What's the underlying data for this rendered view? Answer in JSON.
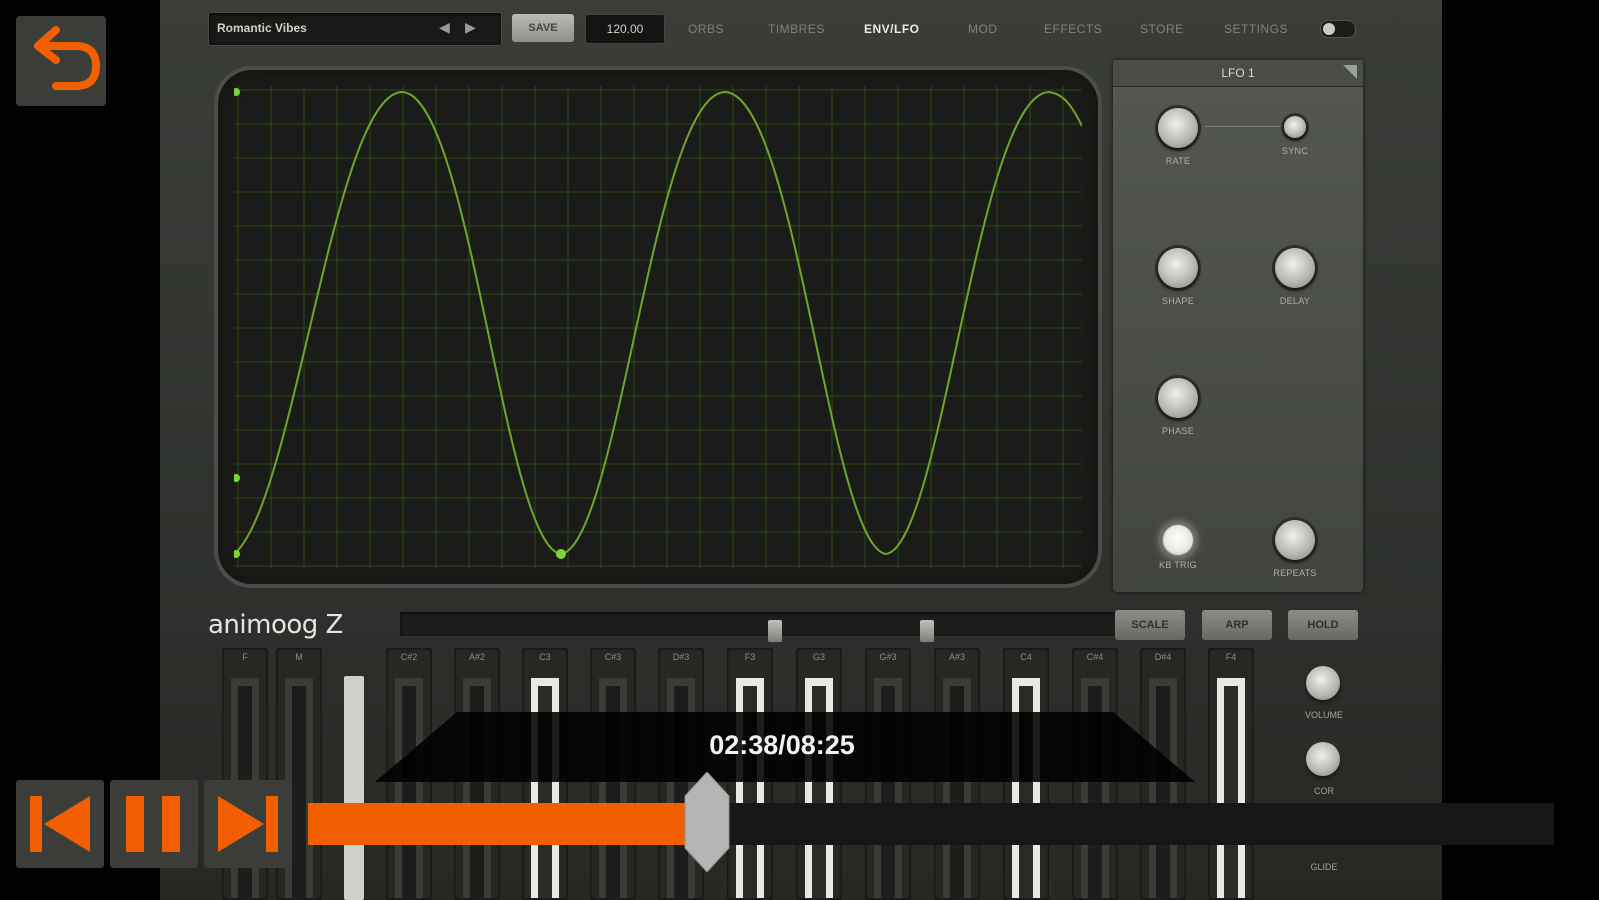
{
  "preset": {
    "name": "Romantic Vibes",
    "save_label": "SAVE",
    "bpm": "120.00"
  },
  "tabs": [
    {
      "label": "ORBS",
      "active": false
    },
    {
      "label": "TIMBRES",
      "active": false
    },
    {
      "label": "ENV/LFO",
      "active": true
    },
    {
      "label": "MOD",
      "active": false
    },
    {
      "label": "EFFECTS",
      "active": false
    },
    {
      "label": "STORE",
      "active": false
    },
    {
      "label": "SETTINGS",
      "active": false
    }
  ],
  "lfo_panel": {
    "title": "LFO 1",
    "knobs": [
      "RATE",
      "SYNC",
      "SHAPE",
      "DELAY",
      "PHASE",
      "KB TRIG",
      "REPEATS"
    ]
  },
  "keyboard": {
    "logo": "animoog Z",
    "buttons": [
      "SCALE",
      "ARP",
      "HOLD"
    ],
    "notes": [
      "F",
      "M",
      "C#2",
      "A#2",
      "C3",
      "C#3",
      "D#3",
      "F3",
      "G3",
      "G#3",
      "A#3",
      "C4",
      "C#4",
      "D#4",
      "F4"
    ],
    "lit_notes": [
      "C3",
      "F3",
      "G3",
      "C4",
      "F4"
    ],
    "side_labels": [
      "VOLUME",
      "COR",
      "GLIDE"
    ]
  },
  "player": {
    "time": "02:38/08:25",
    "progress": 0.32,
    "accent": "#f35e00"
  },
  "icons": {
    "back": "undo-arrow-icon",
    "prev": "skip-previous-icon",
    "pause": "pause-icon",
    "next": "skip-next-icon"
  }
}
